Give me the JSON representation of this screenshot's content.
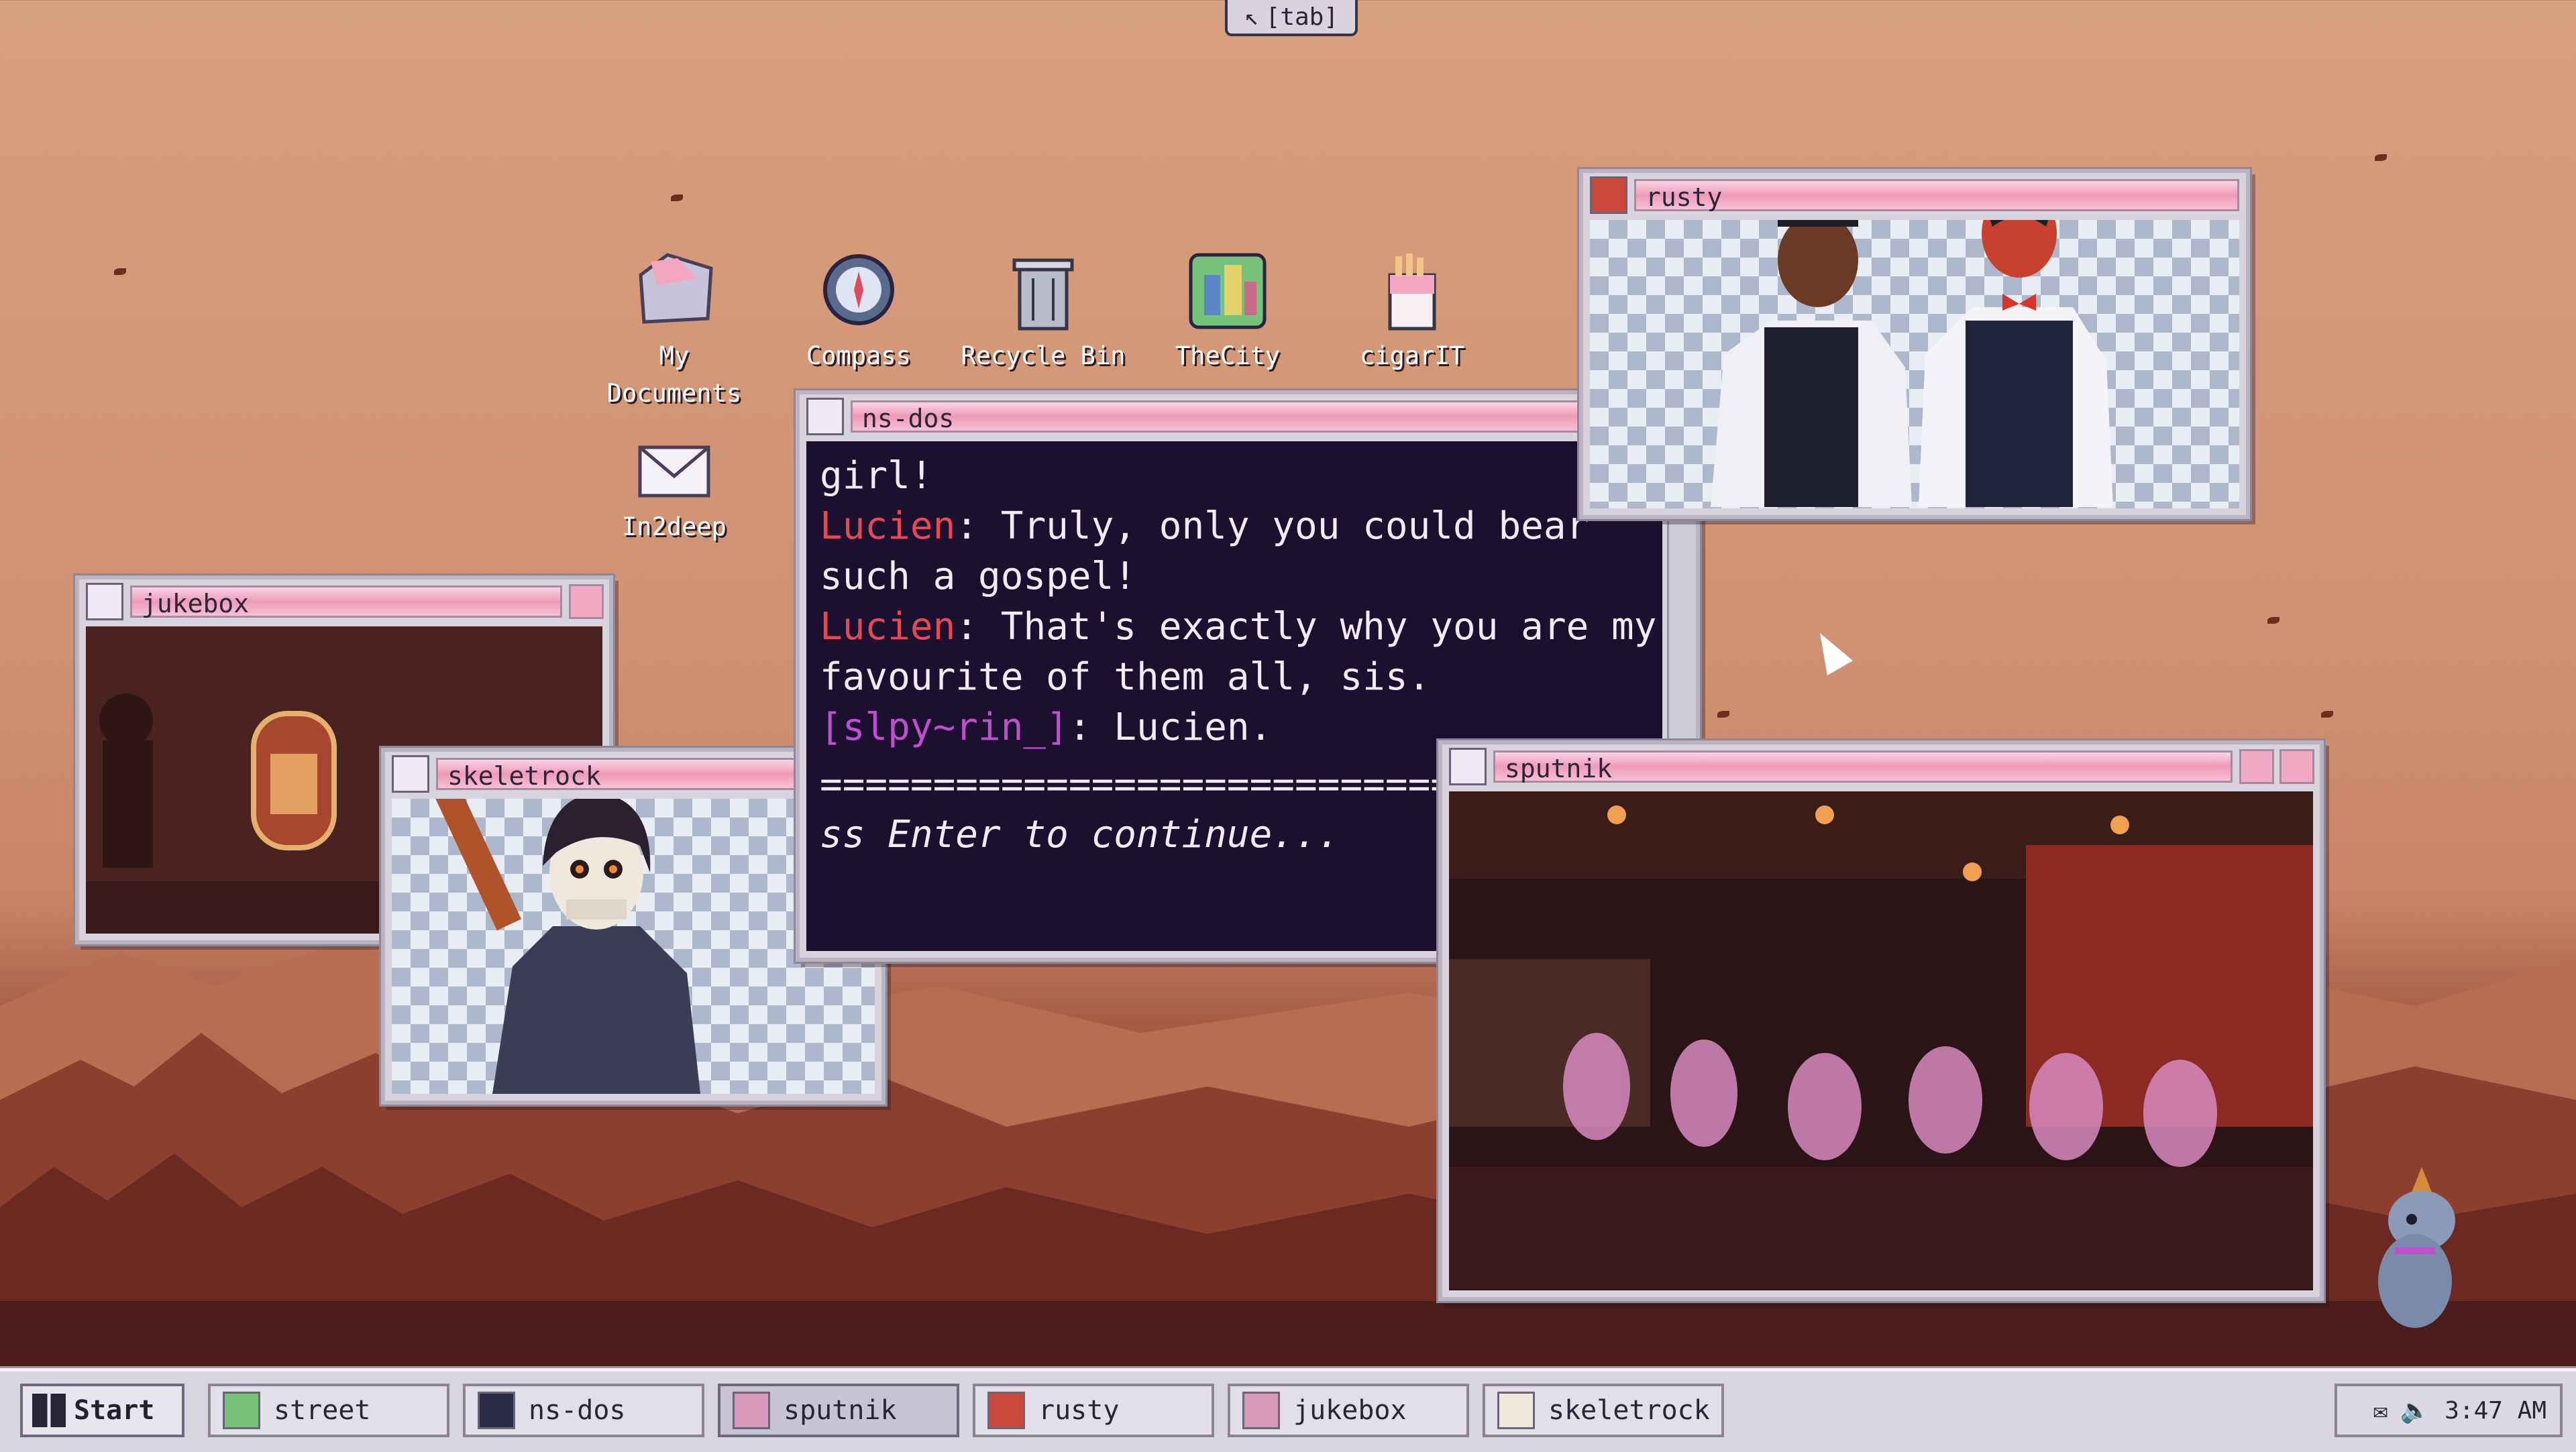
{
  "tab_hint": "[tab]",
  "desktop_icons": [
    {
      "label": "My\nDocuments",
      "icon": "folder-icon"
    },
    {
      "label": "Compass",
      "icon": "compass-icon"
    },
    {
      "label": "Recycle Bin",
      "icon": "recycle-bin-icon"
    },
    {
      "label": "TheCity",
      "icon": "city-icon"
    },
    {
      "label": "cigarIT",
      "icon": "cigarette-pack-icon"
    },
    {
      "label": "In2deep",
      "icon": "mail-icon"
    }
  ],
  "windows": {
    "nsdos": {
      "title": "ns-dos",
      "lines": [
        {
          "speaker": "",
          "text": "girl!"
        },
        {
          "speaker": "Lucien",
          "text": ": Truly, only you could bear"
        },
        {
          "speaker": "",
          "text": "such a gospel!"
        },
        {
          "speaker": "Lucien",
          "text": ": That's exactly why you are my"
        },
        {
          "speaker": "",
          "text": "favourite of them all, sis."
        },
        {
          "speaker": "[slpy~rin_]",
          "text": ": Lucien."
        }
      ],
      "divider": "==================================",
      "prompt": "ss Enter to continue..."
    },
    "rusty": {
      "title": "rusty"
    },
    "jukebox": {
      "title": "jukebox"
    },
    "skeletrock": {
      "title": "skeletrock"
    },
    "sputnik": {
      "title": "sputnik"
    }
  },
  "taskbar": {
    "start_label": "Start",
    "items": [
      {
        "label": "street"
      },
      {
        "label": "ns-dos"
      },
      {
        "label": "sputnik"
      },
      {
        "label": "rusty"
      },
      {
        "label": "jukebox"
      },
      {
        "label": "skeletrock"
      }
    ],
    "clock": "3:47 AM"
  },
  "colors": {
    "title_pink": "#ee9ab9",
    "speaker_red": "#e34a54",
    "username_magenta": "#c04fd0",
    "dos_bg": "#1c1030"
  }
}
